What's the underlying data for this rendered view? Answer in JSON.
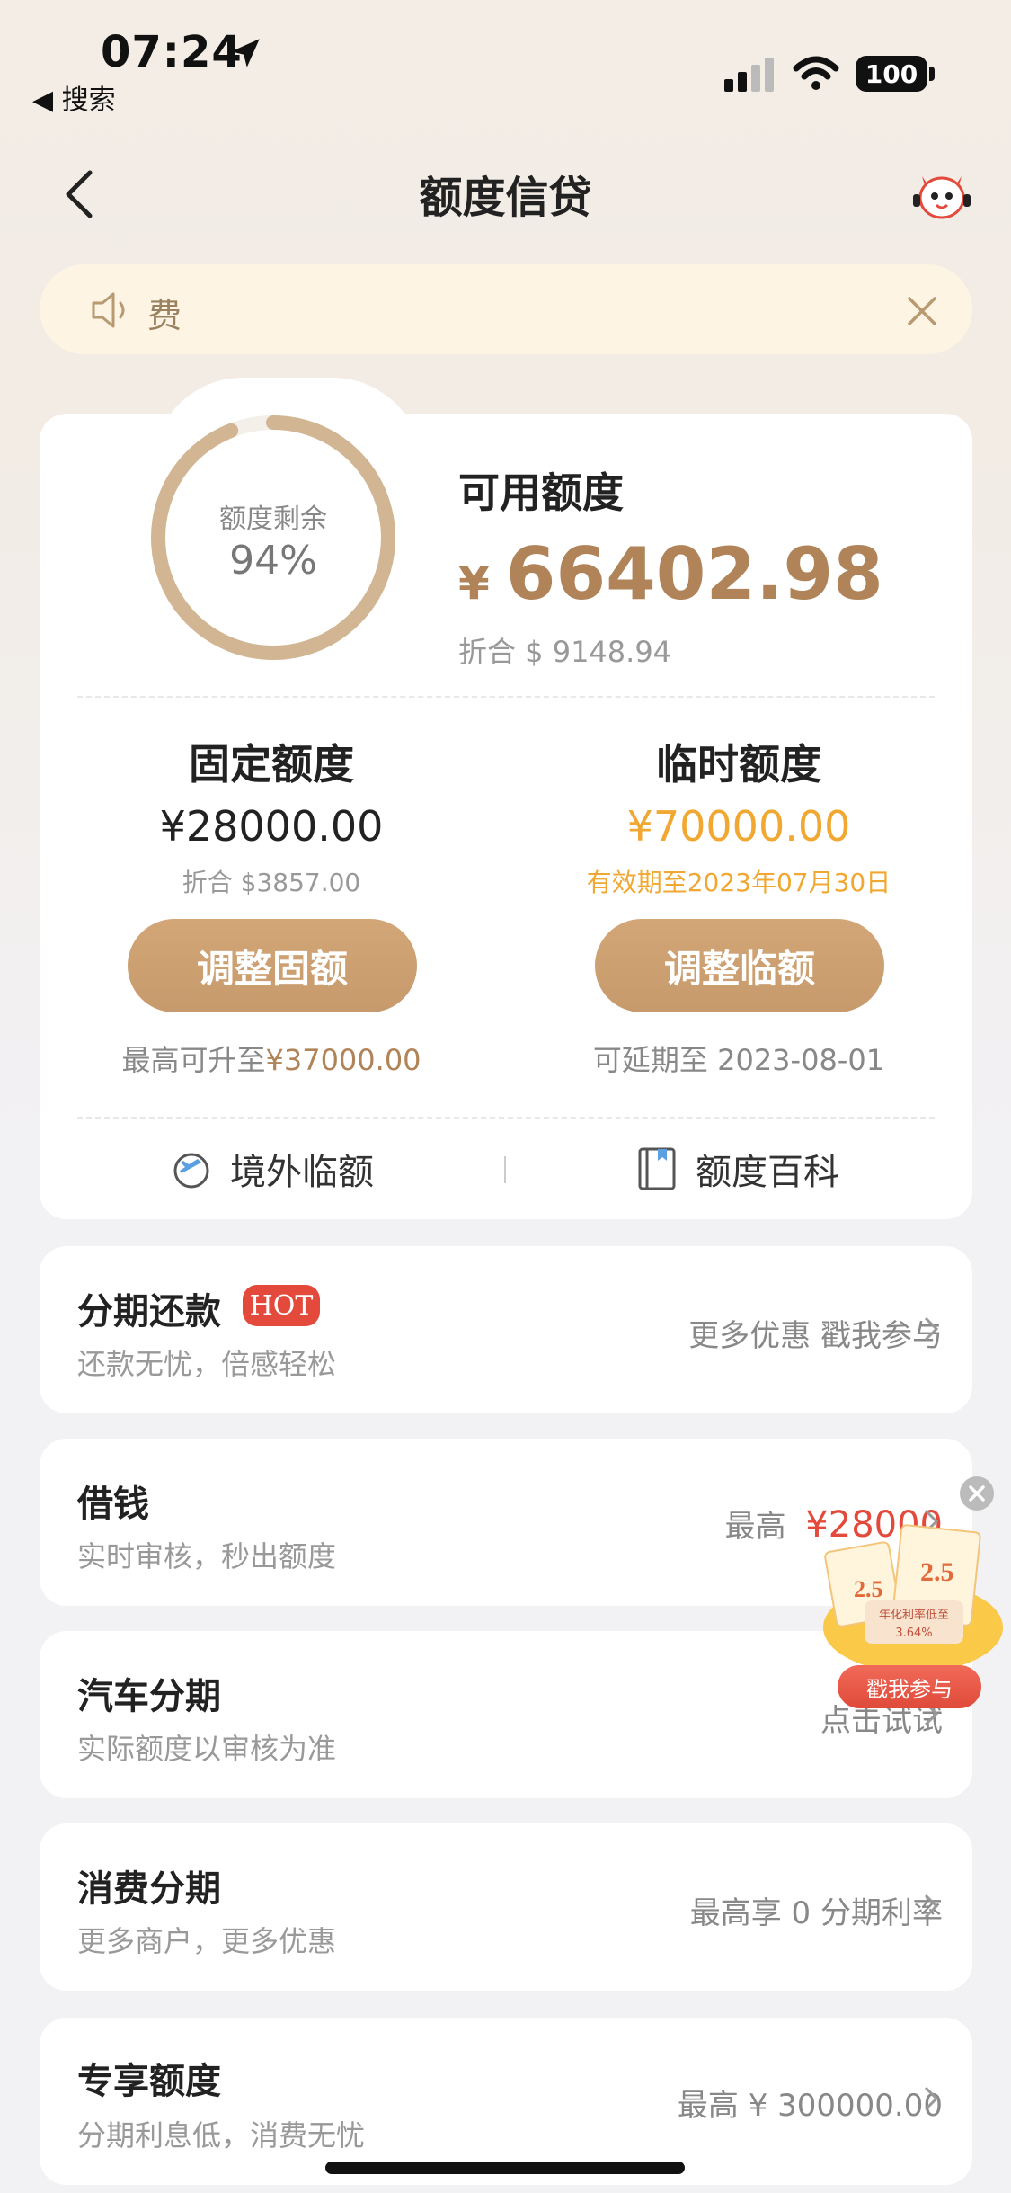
{
  "status_bar": {
    "time": "07:24",
    "back_app": "◀ 搜索",
    "battery": "100"
  },
  "nav": {
    "title": "额度信贷"
  },
  "notice": {
    "text": "费"
  },
  "credit": {
    "ring_label": "额度剩余",
    "ring_percent": "94%",
    "remaining_fraction": 0.94,
    "available_label": "可用额度",
    "currency_symbol": "¥",
    "available_amount": "66402.98",
    "available_usd": "折合 $ 9148.94",
    "fixed": {
      "title": "固定额度",
      "amount": "¥28000.00",
      "usd": "折合 $3857.00",
      "button": "调整固额",
      "note_prefix": "最高可升至",
      "note_value": "¥37000.00"
    },
    "temp": {
      "title": "临时额度",
      "amount": "¥70000.00",
      "validity": "有效期至2023年07月30日",
      "button": "调整临额",
      "note": "可延期至 2023-08-01"
    },
    "links": {
      "overseas": "境外临额",
      "wiki": "额度百科"
    }
  },
  "rows": [
    {
      "title": "分期还款",
      "badge": "HOT",
      "subtitle": "还款无忧，倍感轻松",
      "right": "更多优惠 戳我参与"
    },
    {
      "title": "借钱",
      "subtitle": "实时审核，秒出额度",
      "right_prefix": "最高",
      "right_value": "¥28000"
    },
    {
      "title": "汽车分期",
      "subtitle": "实际额度以审核为准",
      "right": "点击试试"
    },
    {
      "title": "消费分期",
      "subtitle": "更多商户，更多优惠",
      "right": "最高享 0 分期利率"
    },
    {
      "title": "专享额度",
      "subtitle": "分期利息低，消费无忧",
      "right": "最高 ¥ 300000.00"
    }
  ],
  "promo": {
    "button": "戳我参与",
    "figure_small": "2.5",
    "figure_big": "2.5",
    "rate_line1": "年化利率低至",
    "rate_line2": "3.64%"
  },
  "colors": {
    "gold": "#b08458",
    "button": "#c69a6c",
    "orange": "#f0a832",
    "red": "#e34a3c"
  }
}
